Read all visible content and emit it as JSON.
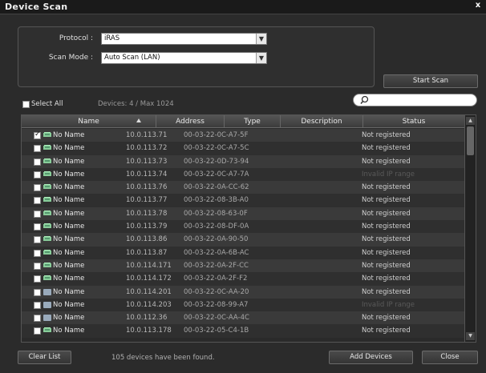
{
  "window": {
    "title": "Device Scan",
    "close_glyph": "x"
  },
  "scan": {
    "protocol_label": "Protocol :",
    "protocol_value": "iRAS",
    "mode_label": "Scan Mode :",
    "mode_value": "Auto Scan (LAN)",
    "start_label": "Start Scan"
  },
  "list": {
    "select_all_label": "Select All",
    "device_count": "Devices: 4 / Max 1024",
    "columns": {
      "name": "Name",
      "address": "Address",
      "type": "Type",
      "description": "Description",
      "status": "Status"
    },
    "rows": [
      {
        "checked": true,
        "icon": "nvr-icon",
        "name": "No Name",
        "ip": "10.0.113.71",
        "mac": "00-03-22-0C-A7-5F",
        "status": "Not registered",
        "dim": false
      },
      {
        "checked": false,
        "icon": "nvr-icon",
        "name": "No Name",
        "ip": "10.0.113.72",
        "mac": "00-03-22-0C-A7-5C",
        "status": "Not registered",
        "dim": false
      },
      {
        "checked": false,
        "icon": "nvr-icon",
        "name": "No Name",
        "ip": "10.0.113.73",
        "mac": "00-03-22-0D-73-94",
        "status": "Not registered",
        "dim": false
      },
      {
        "checked": false,
        "icon": "nvr-icon",
        "name": "No Name",
        "ip": "10.0.113.74",
        "mac": "00-03-22-0C-A7-7A",
        "status": "Invalid IP range",
        "dim": true
      },
      {
        "checked": false,
        "icon": "nvr-icon",
        "name": "No Name",
        "ip": "10.0.113.76",
        "mac": "00-03-22-0A-CC-62",
        "status": "Not registered",
        "dim": false
      },
      {
        "checked": false,
        "icon": "nvr-icon",
        "name": "No Name",
        "ip": "10.0.113.77",
        "mac": "00-03-22-08-3B-A0",
        "status": "Not registered",
        "dim": false
      },
      {
        "checked": false,
        "icon": "nvr-icon",
        "name": "No Name",
        "ip": "10.0.113.78",
        "mac": "00-03-22-08-63-0F",
        "status": "Not registered",
        "dim": false
      },
      {
        "checked": false,
        "icon": "nvr-icon",
        "name": "No Name",
        "ip": "10.0.113.79",
        "mac": "00-03-22-08-DF-0A",
        "status": "Not registered",
        "dim": false
      },
      {
        "checked": false,
        "icon": "nvr-icon",
        "name": "No Name",
        "ip": "10.0.113.86",
        "mac": "00-03-22-0A-90-50",
        "status": "Not registered",
        "dim": false
      },
      {
        "checked": false,
        "icon": "nvr-icon",
        "name": "No Name",
        "ip": "10.0.113.87",
        "mac": "00-03-22-0A-6B-AC",
        "status": "Not registered",
        "dim": false
      },
      {
        "checked": false,
        "icon": "nvr-icon",
        "name": "No Name",
        "ip": "10.0.114.171",
        "mac": "00-03-22-0A-2F-CC",
        "status": "Not registered",
        "dim": false
      },
      {
        "checked": false,
        "icon": "nvr-icon",
        "name": "No Name",
        "ip": "10.0.114.172",
        "mac": "00-03-22-0A-2F-F2",
        "status": "Not registered",
        "dim": false
      },
      {
        "checked": false,
        "icon": "camera-icon",
        "name": "No Name",
        "ip": "10.0.114.201",
        "mac": "00-03-22-0C-AA-20",
        "status": "Not registered",
        "dim": false
      },
      {
        "checked": false,
        "icon": "camera-icon",
        "name": "No Name",
        "ip": "10.0.114.203",
        "mac": "00-03-22-08-99-A7",
        "status": "Invalid IP range",
        "dim": true
      },
      {
        "checked": false,
        "icon": "camera-icon",
        "name": "No Name",
        "ip": "10.0.112.36",
        "mac": "00-03-22-0C-AA-4C",
        "status": "Not registered",
        "dim": false
      },
      {
        "checked": false,
        "icon": "nvr-icon",
        "name": "No Name",
        "ip": "10.0.113.178",
        "mac": "00-03-22-05-C4-1B",
        "status": "Not registered",
        "dim": false
      }
    ]
  },
  "footer": {
    "clear_label": "Clear List",
    "found_text": "105 devices have been found.",
    "add_label": "Add Devices",
    "close_label": "Close"
  }
}
